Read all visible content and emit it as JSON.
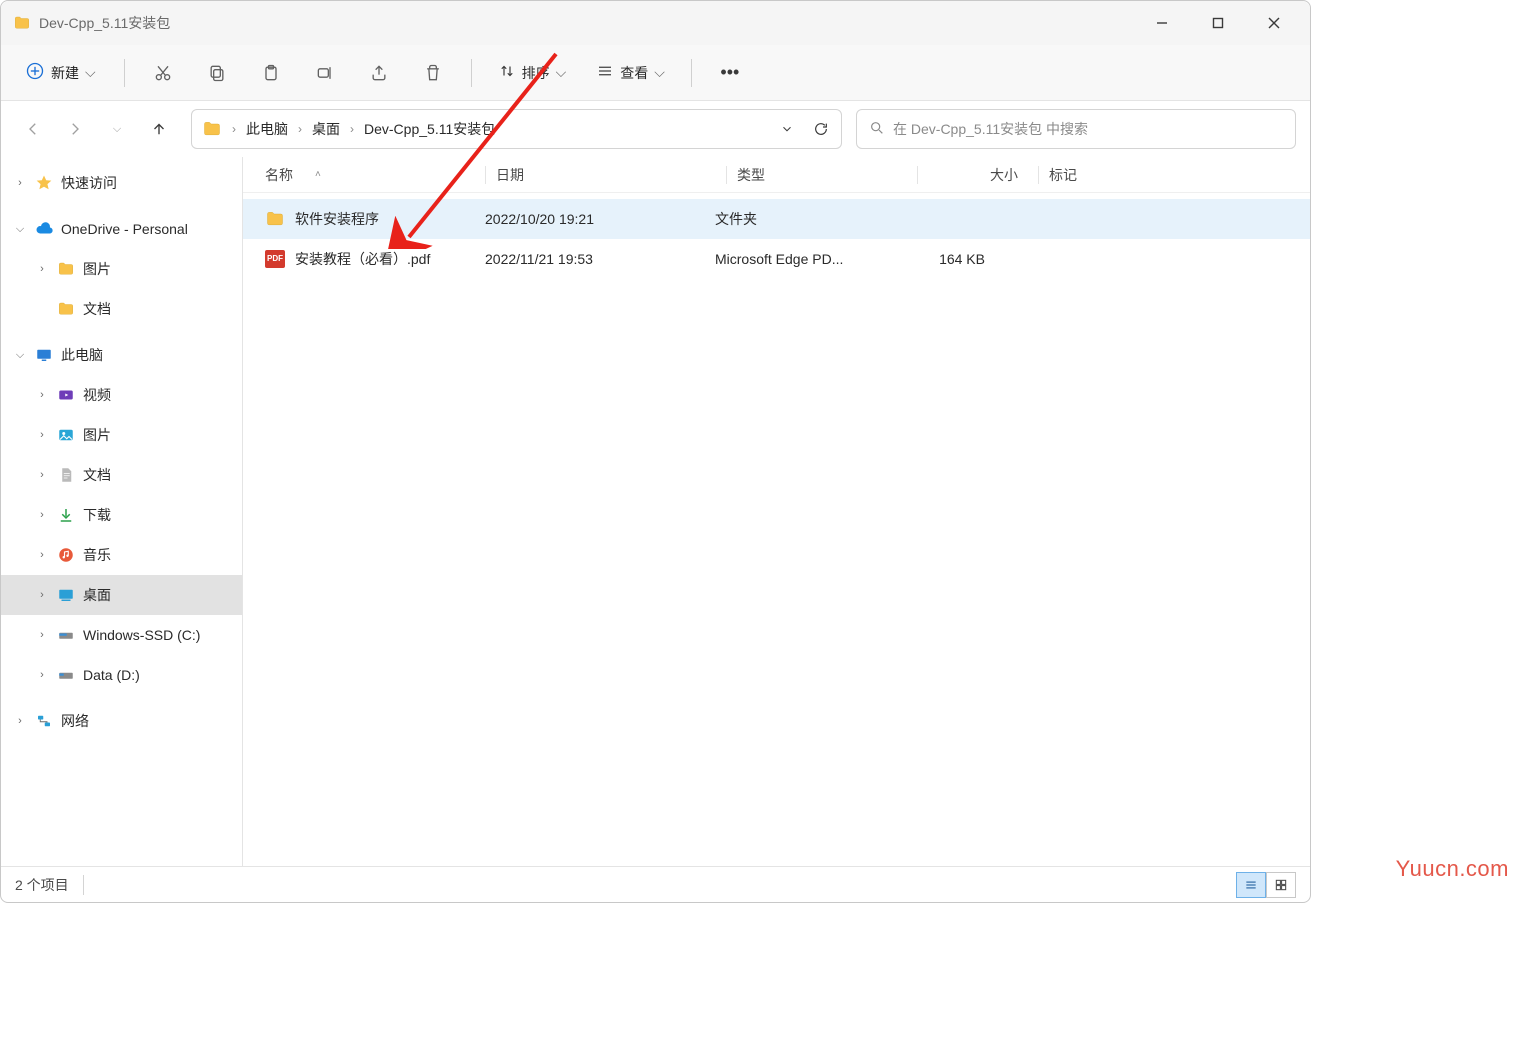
{
  "title": "Dev-Cpp_5.11安装包",
  "toolbar": {
    "new_label": "新建",
    "sort_label": "排序",
    "view_label": "查看"
  },
  "breadcrumb": [
    "此电脑",
    "桌面",
    "Dev-Cpp_5.11安装包"
  ],
  "search": {
    "placeholder": "在 Dev-Cpp_5.11安装包 中搜索"
  },
  "sidebar": {
    "quick_access": "快速访问",
    "onedrive": "OneDrive - Personal",
    "od_pics": "图片",
    "od_docs": "文档",
    "this_pc": "此电脑",
    "videos": "视频",
    "pictures": "图片",
    "documents": "文档",
    "downloads": "下载",
    "music": "音乐",
    "desktop": "桌面",
    "drive_c": "Windows-SSD (C:)",
    "drive_d": "Data (D:)",
    "network": "网络"
  },
  "columns": {
    "name": "名称",
    "date": "日期",
    "type": "类型",
    "size": "大小",
    "tag": "标记"
  },
  "files": [
    {
      "icon": "folder",
      "name": "软件安装程序",
      "date": "2022/10/20 19:21",
      "type": "文件夹",
      "size": ""
    },
    {
      "icon": "pdf",
      "name": "安装教程（必看）.pdf",
      "date": "2022/11/21 19:53",
      "type": "Microsoft Edge PD...",
      "size": "164 KB"
    }
  ],
  "status": {
    "count": "2 个项目"
  },
  "watermark": "Yuucn.com"
}
